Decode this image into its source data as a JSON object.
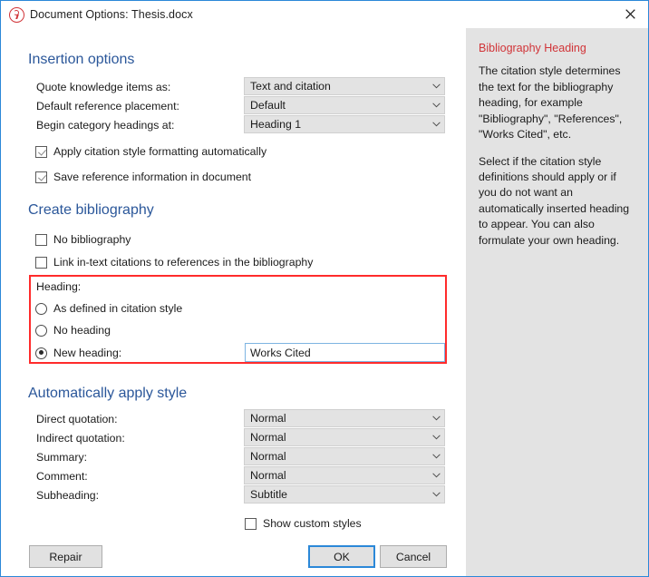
{
  "window": {
    "title": "Document Options: Thesis.docx",
    "close_icon": "close-icon",
    "app_icon": "citavi-logo-icon",
    "accent_color": "#2b88d8",
    "heading_color": "#2b579a",
    "highlight_color": "#ff2b2b"
  },
  "insertion_options": {
    "title": "Insertion options",
    "fields": [
      {
        "label": "Quote knowledge items as:",
        "value": "Text and citation"
      },
      {
        "label": "Default reference placement:",
        "value": "Default"
      },
      {
        "label": "Begin category headings at:",
        "value": "Heading 1"
      }
    ],
    "checkboxes": [
      {
        "label": "Apply citation style formatting automatically",
        "checked": true
      },
      {
        "label": "Save reference information in document",
        "checked": true
      }
    ]
  },
  "create_bibliography": {
    "title": "Create bibliography",
    "checkboxes": [
      {
        "label": "No bibliography",
        "checked": false
      },
      {
        "label": "Link in-text citations to references in the bibliography",
        "checked": false
      }
    ],
    "heading_group": {
      "label": "Heading:",
      "options": [
        {
          "label": "As defined in citation style",
          "selected": false
        },
        {
          "label": "No heading",
          "selected": false
        },
        {
          "label": "New heading:",
          "selected": true
        }
      ],
      "new_heading_value": "Works Cited",
      "new_heading_placeholder": ""
    }
  },
  "automatically_apply_style": {
    "title": "Automatically apply style",
    "fields": [
      {
        "label": "Direct quotation:",
        "value": "Normal"
      },
      {
        "label": "Indirect quotation:",
        "value": "Normal"
      },
      {
        "label": "Summary:",
        "value": "Normal"
      },
      {
        "label": "Comment:",
        "value": "Normal"
      },
      {
        "label": "Subheading:",
        "value": "Subtitle"
      }
    ],
    "show_custom_styles": {
      "label": "Show custom styles",
      "checked": false
    }
  },
  "footer": {
    "repair_label": "Repair",
    "ok_label": "OK",
    "cancel_label": "Cancel"
  },
  "help_panel": {
    "title": "Bibliography Heading",
    "paragraphs": [
      "The citation style determines the text for the bibliography heading, for example \"Bibliography\", \"References\", \"Works Cited\", etc.",
      "Select if the citation style definitions should apply or if you do not want an automatically inserted heading to appear. You can also formulate your own heading."
    ]
  }
}
